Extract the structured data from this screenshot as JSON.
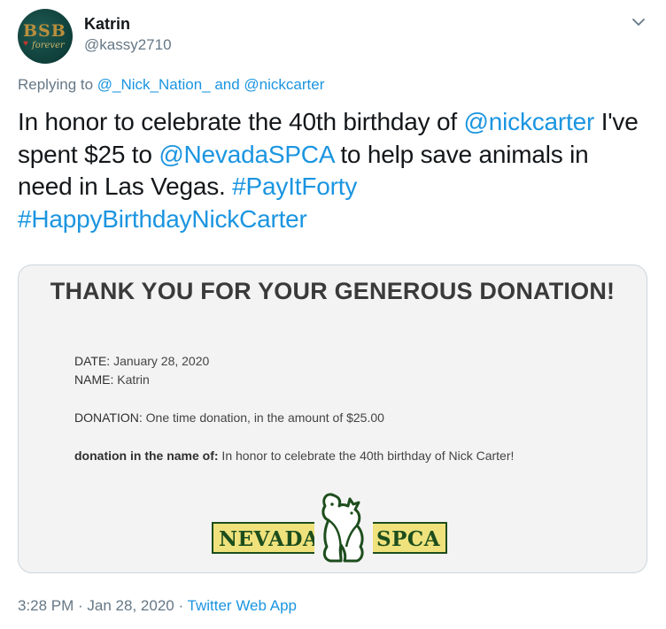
{
  "user": {
    "display_name": "Katrin",
    "handle": "@kassy2710",
    "avatar_text": "BSB",
    "avatar_subtext": "forever"
  },
  "replying": {
    "prefix": "Replying to ",
    "user1": "@_Nick_Nation_",
    "joiner": " and ",
    "user2": "@nickcarter"
  },
  "tweet": {
    "part1": "In honor to celebrate the 40th birthday of ",
    "mention1": "@nickcarter",
    "part2": " I've spent $25 to ",
    "mention2": "@NevadaSPCA",
    "part3": " to help save animals in need in Las Vegas. ",
    "hashtag1": "#PayItForty",
    "hashtag2": "#HappyBirthdayNickCarter"
  },
  "card": {
    "title": "THANK YOU FOR YOUR GENEROUS DONATION!",
    "date_label": "DATE:",
    "date_value": " January 28, 2020",
    "name_label": "NAME:",
    "name_value": " Katrin",
    "donation_label": "DONATION:",
    "donation_value": " One time donation, in the amount of $25.00",
    "in_name_label": "donation in the name of:",
    "in_name_value": " In honor to celebrate the 40th birthday of Nick Carter!",
    "logo_left": "NEVADA",
    "logo_right": "SPCA"
  },
  "footer": {
    "time": "3:28 PM · Jan 28, 2020 · ",
    "source": "Twitter Web App"
  },
  "colors": {
    "link": "#1b95e0",
    "muted": "#657786",
    "logo_fill": "#efe27c",
    "logo_green": "#1d4d1d"
  }
}
